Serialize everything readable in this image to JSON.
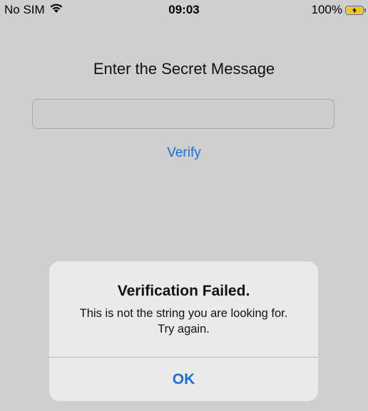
{
  "status_bar": {
    "carrier": "No SIM",
    "time": "09:03",
    "battery_percent": "100%",
    "battery_level": 1.0,
    "battery_color": "#f5c518",
    "wifi_icon": "wifi-icon",
    "charging_icon": "lightning-bolt-icon"
  },
  "screen": {
    "title": "Enter the Secret Message",
    "input_value": "",
    "input_placeholder": "",
    "verify_label": "Verify",
    "accent_color": "#1f6fd1"
  },
  "alert": {
    "title": "Verification Failed.",
    "message": "This is not the string you are looking for. Try again.",
    "ok_label": "OK"
  }
}
